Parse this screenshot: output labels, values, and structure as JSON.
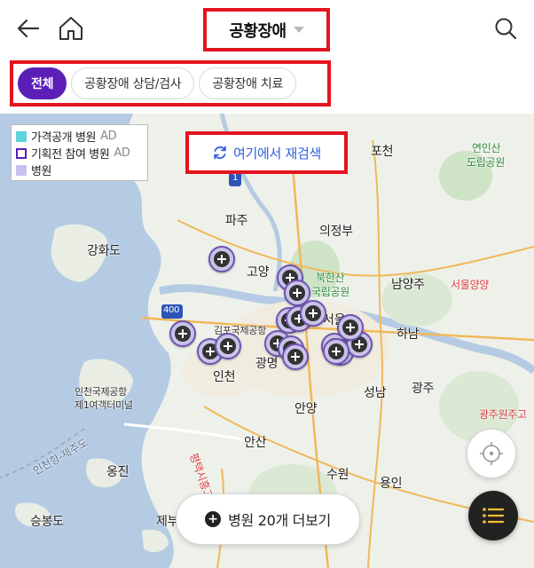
{
  "header": {
    "title": "공황장애",
    "back_icon": "arrow-left-icon",
    "home_icon": "home-icon",
    "search_icon": "search-icon"
  },
  "tabs": [
    {
      "label": "전체",
      "active": true
    },
    {
      "label": "공황장애 상담/검사",
      "active": false
    },
    {
      "label": "공황장애 치료",
      "active": false
    }
  ],
  "legend": {
    "items": [
      {
        "label": "가격공개 병원",
        "ad": "AD",
        "swatch": "#5ed4d8"
      },
      {
        "label": "기획전 참여 병원",
        "ad": "AD",
        "swatch": "#5b1fb8"
      },
      {
        "label": "병원",
        "ad": "",
        "swatch": "#c9bff0"
      }
    ]
  },
  "research_button": {
    "label": "여기에서 재검색",
    "icon": "refresh-icon"
  },
  "map": {
    "places": {
      "pocheon": "포천",
      "yeoninsan": "연인산",
      "yeoninsan_park": "도립공원",
      "paju": "파주",
      "uijeongbu": "의정부",
      "ganghwado": "강화도",
      "goyang": "고양",
      "bukhansan": "북한산",
      "bukhansan_park": "국립공원",
      "namyangju": "남양주",
      "seoul_yangyang": "서울양양",
      "gimpo_airport": "김포국제공항",
      "seoul": "서울",
      "hanam": "하남",
      "incheon": "인천",
      "gwangmyeong": "광명",
      "incheon_airport": "인천국제공항",
      "incheon_terminal": "제1여객터미널",
      "seongnam": "성남",
      "gwangju": "광주",
      "gwangju_wonju": "광주원주고",
      "anyang": "안양",
      "ansan": "안산",
      "yeongjin": "옹진",
      "suwon": "수원",
      "yongin": "용인",
      "seungbongdo": "승봉도",
      "jebu": "제부",
      "pyeongtaek_siheung": "평택시흥고",
      "incheon_jeju": "인천항-제주도",
      "highway_400": "400",
      "highway_1": "1"
    }
  },
  "markers_count": 22,
  "more_button": {
    "label": "병원 20개 더보기",
    "icon": "plus-circle-icon"
  },
  "locate_button": {
    "icon": "crosshair-icon"
  },
  "list_button": {
    "icon": "list-icon"
  },
  "colors": {
    "accent": "#5b1fb8",
    "highlight_border": "#e4141e",
    "research_text": "#2e5fe0",
    "marker_fill": "#c9c3e8",
    "list_icon": "#f2c230"
  }
}
